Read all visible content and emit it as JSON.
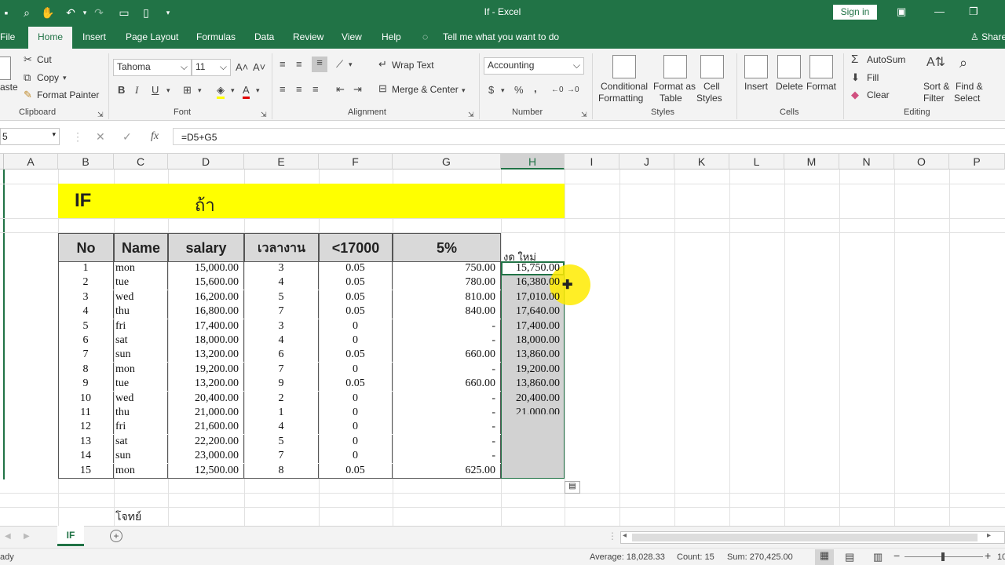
{
  "window": {
    "title": "If  -  Excel",
    "signin": "Sign in"
  },
  "tabs": [
    "File",
    "Home",
    "Insert",
    "Page Layout",
    "Formulas",
    "Data",
    "Review",
    "View",
    "Help",
    "Tell me what you want to do",
    "Share"
  ],
  "ribbon": {
    "clipboard": {
      "paste": "aste",
      "cut": "Cut",
      "copy": "Copy",
      "format_painter": "Format Painter",
      "group": "Clipboard"
    },
    "font": {
      "name": "Tahoma",
      "size": "11",
      "bold": "B",
      "italic": "I",
      "underline": "U",
      "group": "Font"
    },
    "alignment": {
      "wrap": "Wrap Text",
      "merge": "Merge & Center",
      "group": "Alignment"
    },
    "number": {
      "format": "Accounting",
      "percent": "%",
      "comma": ",",
      "group": "Number"
    },
    "styles": {
      "conditional": "Conditional",
      "conditional2": "Formatting",
      "format_as": "Format as",
      "format_as2": "Table",
      "cell": "Cell",
      "cell2": "Styles",
      "group": "Styles"
    },
    "cells": {
      "insert": "Insert",
      "delete": "Delete",
      "format": "Format",
      "group": "Cells"
    },
    "editing": {
      "autosum": "AutoSum",
      "fill": "Fill",
      "clear": "Clear",
      "sort": "Sort &",
      "sort2": "Filter",
      "find": "Find &",
      "find2": "Select",
      "group": "Editing"
    }
  },
  "formula": {
    "name_box": "5",
    "fx": "fx",
    "content": "=D5+G5"
  },
  "columns": [
    "A",
    "B",
    "C",
    "D",
    "E",
    "F",
    "G",
    "H",
    "I",
    "J",
    "K",
    "L",
    "M",
    "N",
    "O",
    "P"
  ],
  "sheet": {
    "banner_left": "IF",
    "banner_right": "ถ้า",
    "headers": [
      "No",
      "Name",
      "salary",
      "เวลางาน",
      "<17000",
      "5%"
    ],
    "h_header": "งด ใหม่",
    "rows": [
      [
        "1",
        "mon",
        "15,000.00",
        "3",
        "0.05",
        "750.00",
        "15,750.00"
      ],
      [
        "2",
        "tue",
        "15,600.00",
        "4",
        "0.05",
        "780.00",
        "16,380.00"
      ],
      [
        "3",
        "wed",
        "16,200.00",
        "5",
        "0.05",
        "810.00",
        "17,010.00"
      ],
      [
        "4",
        "thu",
        "16,800.00",
        "7",
        "0.05",
        "840.00",
        "17,640.00"
      ],
      [
        "5",
        "fri",
        "17,400.00",
        "3",
        "0",
        "-",
        "17,400.00"
      ],
      [
        "6",
        "sat",
        "18,000.00",
        "4",
        "0",
        "-",
        "18,000.00"
      ],
      [
        "7",
        "sun",
        "13,200.00",
        "6",
        "0.05",
        "660.00",
        "13,860.00"
      ],
      [
        "8",
        "mon",
        "19,200.00",
        "7",
        "0",
        "-",
        "19,200.00"
      ],
      [
        "9",
        "tue",
        "13,200.00",
        "9",
        "0.05",
        "660.00",
        "13,860.00"
      ],
      [
        "10",
        "wed",
        "20,400.00",
        "2",
        "0",
        "-",
        "20,400.00"
      ],
      [
        "11",
        "thu",
        "21,000.00",
        "1",
        "0",
        "-",
        "21,000.00"
      ],
      [
        "12",
        "fri",
        "21,600.00",
        "4",
        "0",
        "-",
        ""
      ],
      [
        "13",
        "sat",
        "22,200.00",
        "5",
        "0",
        "-",
        ""
      ],
      [
        "14",
        "sun",
        "23,000.00",
        "7",
        "0",
        "-",
        ""
      ],
      [
        "15",
        "mon",
        "12,500.00",
        "8",
        "0.05",
        "625.00",
        ""
      ]
    ],
    "note": "โจทย์"
  },
  "sheet_tab": "IF",
  "status": {
    "ready": "ady",
    "average": "Average: 18,028.33",
    "count": "Count: 15",
    "sum": "Sum: 270,425.00",
    "zoom": "10"
  },
  "colors": {
    "excel_green": "#217346",
    "banner": "#ffff00",
    "header_gray": "#d9d9d9",
    "selection": "#d2d2d2"
  }
}
